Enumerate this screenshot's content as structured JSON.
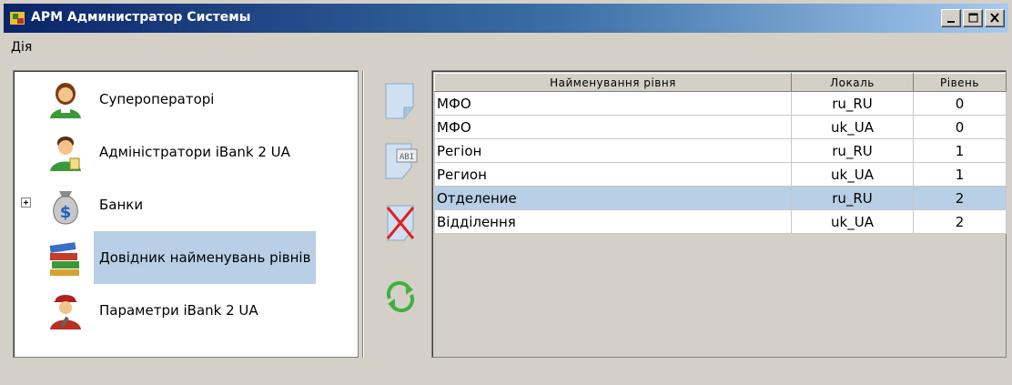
{
  "window": {
    "title": "АРМ Администратор Системы"
  },
  "menu": {
    "items": [
      "Дія"
    ]
  },
  "tree": {
    "items": [
      {
        "label": "Супероператорі",
        "icon": "superoperator-icon"
      },
      {
        "label": "Адміністратори iBank 2 UA",
        "icon": "administrator-icon"
      },
      {
        "label": "Банки",
        "icon": "money-bag-icon",
        "expandable": true
      },
      {
        "label": "Довідник найменувань рівнів",
        "icon": "books-icon",
        "selected": true
      },
      {
        "label": "Параметри iBank 2 UA",
        "icon": "parameters-user-icon"
      }
    ]
  },
  "toolbar": {
    "buttons": [
      "new-document-icon",
      "edit-document-icon",
      "delete-document-icon",
      "refresh-icon"
    ]
  },
  "table": {
    "headers": [
      "Найменування рівня",
      "Локаль",
      "Рівень"
    ],
    "rows": [
      [
        "МФО",
        "ru_RU",
        "0"
      ],
      [
        "МФО",
        "uk_UA",
        "0"
      ],
      [
        "Регіон",
        "ru_RU",
        "1"
      ],
      [
        "Регион",
        "uk_UA",
        "1"
      ],
      [
        "Отделение",
        "ru_RU",
        "2"
      ],
      [
        "Відділення",
        "uk_UA",
        "2"
      ]
    ],
    "selected_row": 4
  },
  "colors": {
    "selection": "#b8cfe5",
    "titlebar_start": "#0a246a",
    "titlebar_end": "#a6caf0"
  }
}
